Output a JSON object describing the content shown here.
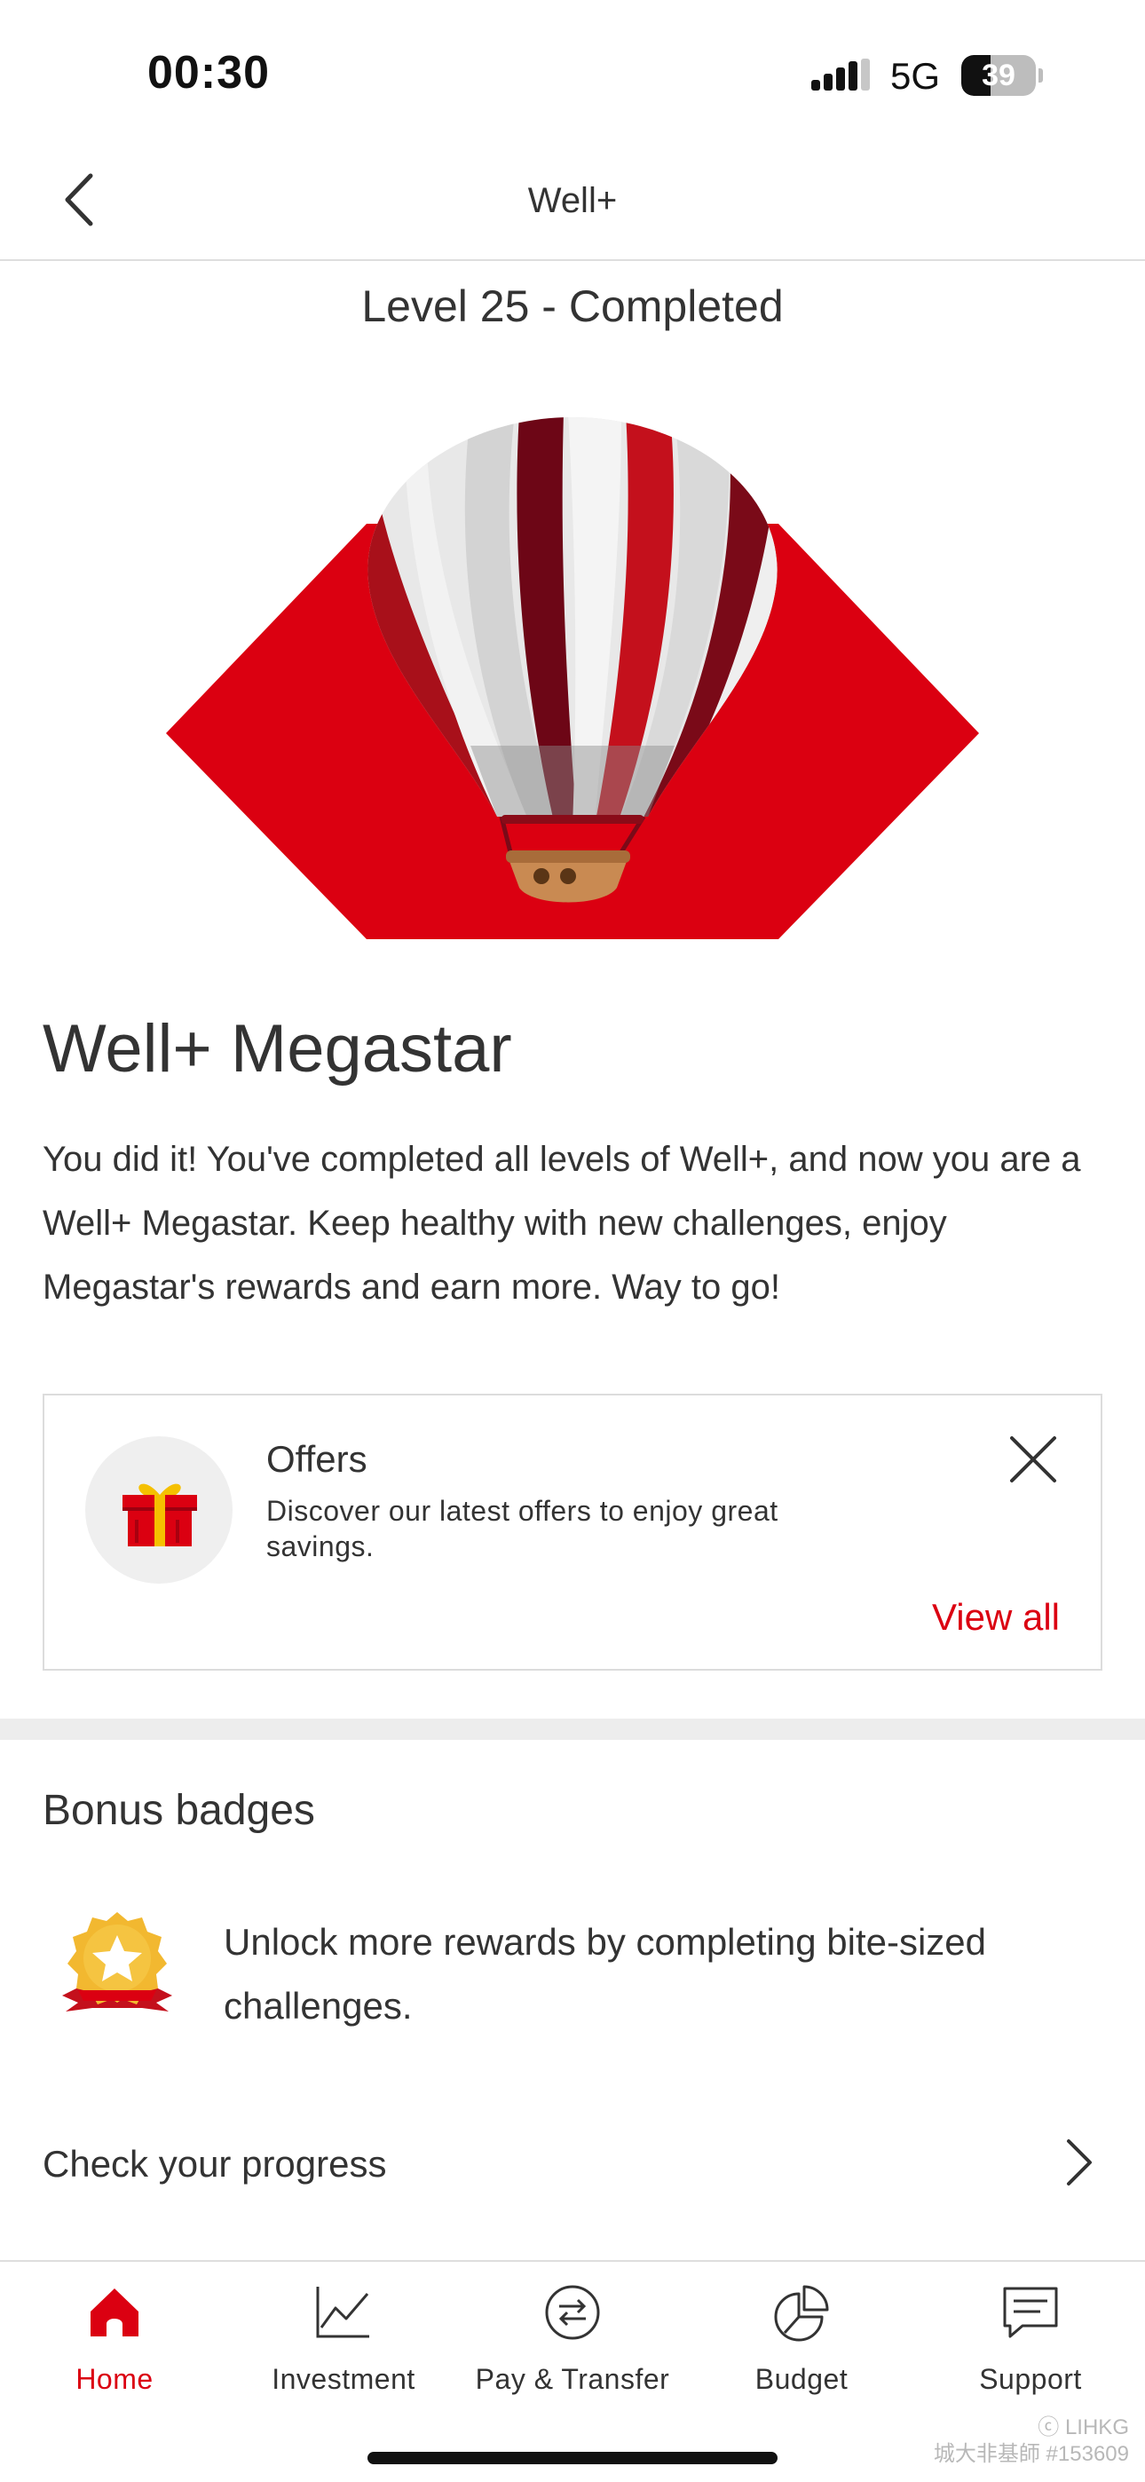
{
  "status_bar": {
    "time": "00:30",
    "network": "5G",
    "battery": "39",
    "battery_level": 0.39
  },
  "header": {
    "title": "Well+"
  },
  "level": {
    "title": "Level 25 - Completed"
  },
  "main": {
    "headline": "Well+ Megastar",
    "description": "You did it! You've completed all levels of Well+, and now you are a Well+ Megastar. Keep healthy with new challenges, enjoy Megastar's rewards and earn more. Way to go!"
  },
  "offers": {
    "title": "Offers",
    "description": "Discover our latest offers to enjoy great savings.",
    "view_all_label": "View all",
    "icon": "gift-icon"
  },
  "bonus": {
    "title": "Bonus badges",
    "text": "Unlock more rewards by completing bite-sized challenges.",
    "icon": "badge-icon"
  },
  "progress": {
    "label": "Check your progress"
  },
  "tabs": [
    {
      "label": "Home",
      "icon": "home-icon",
      "active": true
    },
    {
      "label": "Investment",
      "icon": "chart-icon",
      "active": false
    },
    {
      "label": "Pay & Transfer",
      "icon": "transfer-icon",
      "active": false
    },
    {
      "label": "Budget",
      "icon": "pie-icon",
      "active": false
    },
    {
      "label": "Support",
      "icon": "chat-icon",
      "active": false
    }
  ],
  "watermark": {
    "line1": "ⓒ LIHKG",
    "line2": "城大非基師 #153609"
  },
  "colors": {
    "brand_red": "#db0011",
    "text": "#333333",
    "divider": "#ededed"
  }
}
